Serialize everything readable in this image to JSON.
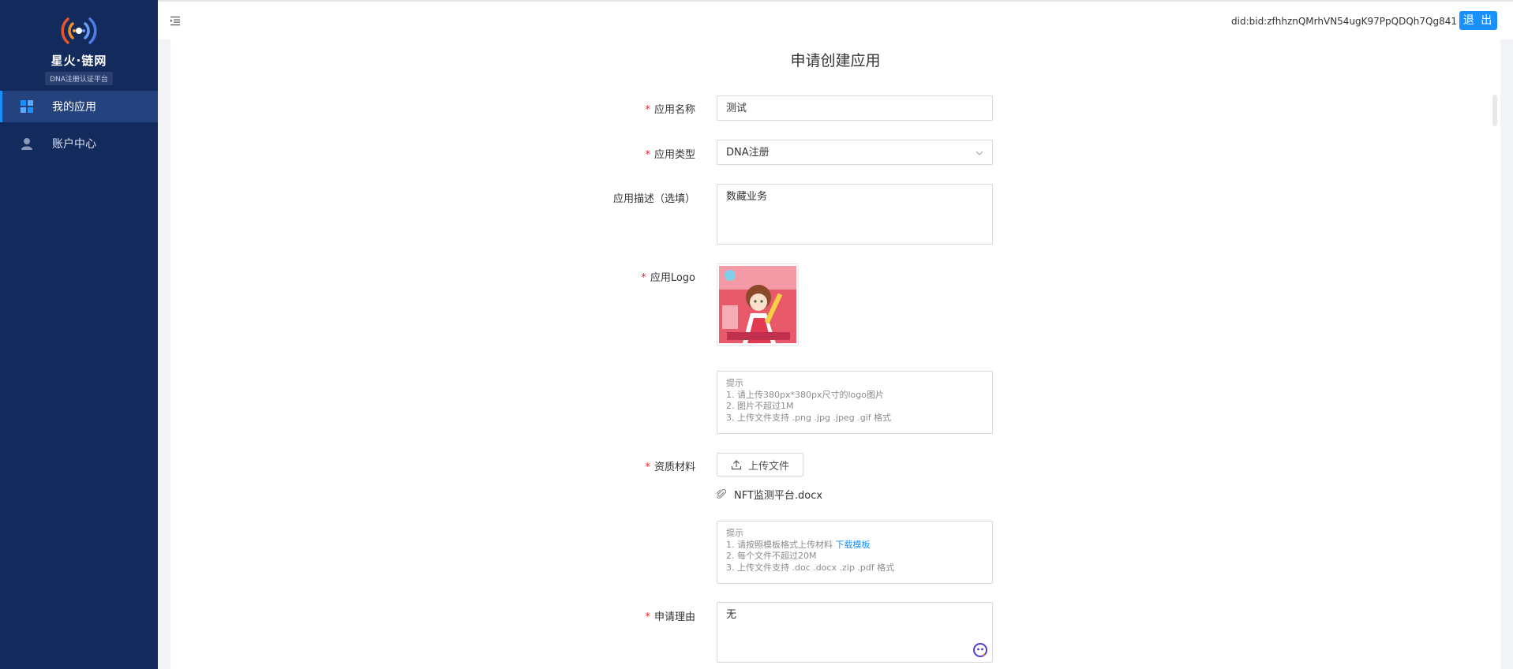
{
  "sidebar": {
    "brand": "星火·链网",
    "brand_sub": "DNA注册认证平台",
    "items": [
      {
        "label": "我的应用",
        "icon": "grid-icon",
        "active": true
      },
      {
        "label": "账户中心",
        "icon": "user-icon",
        "active": false
      }
    ]
  },
  "header": {
    "did": "did:bid:zfhhznQMrhVN54ugK97PpQDQh7Qg841",
    "logout": "退 出"
  },
  "form": {
    "title": "申请创建应用",
    "name": {
      "label": "应用名称",
      "required": true,
      "value": "测试"
    },
    "type": {
      "label": "应用类型",
      "required": true,
      "value": "DNA注册"
    },
    "desc": {
      "label": "应用描述（选填）",
      "required": false,
      "value": "数藏业务"
    },
    "logo": {
      "label": "应用Logo",
      "required": true
    },
    "logo_hint": {
      "title": "提示",
      "line1": "1. 请上传380px*380px尺寸的logo图片",
      "line2": "2. 图片不超过1M",
      "line3": "3. 上传文件支持 .png .jpg .jpeg .gif 格式"
    },
    "material": {
      "label": "资质材料",
      "required": true,
      "upload_label": "上传文件",
      "file_name": "NFT监测平台.docx"
    },
    "material_hint": {
      "title": "提示",
      "line1": "1. 请按照模板格式上传材料",
      "link": "下载模板",
      "line2": "2. 每个文件不超过20M",
      "line3": "3. 上传文件支持 .doc .docx .zip .pdf 格式"
    },
    "reason": {
      "label": "申请理由",
      "required": true,
      "value": "无"
    }
  },
  "colors": {
    "sidebar_bg": "#132a5c",
    "accent": "#1890ff",
    "required": "#f5222d"
  }
}
